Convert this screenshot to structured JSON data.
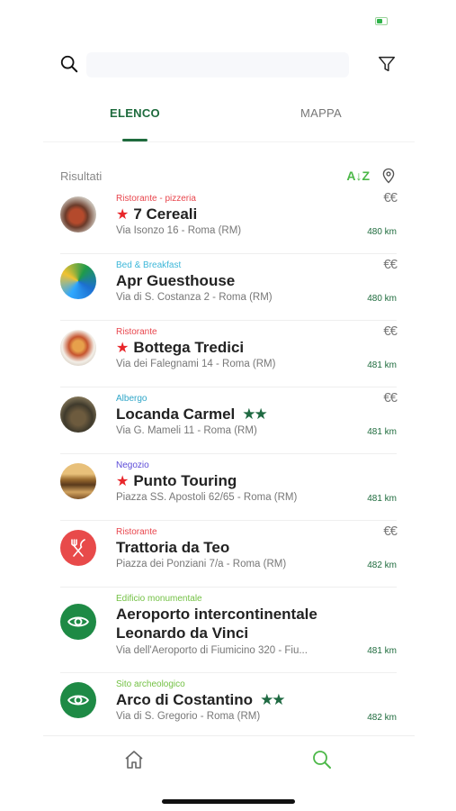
{
  "search": {
    "placeholder": "",
    "value": ""
  },
  "tabs": [
    {
      "label": "ELENCO",
      "active": true
    },
    {
      "label": "MAPPA",
      "active": false
    }
  ],
  "results": {
    "label": "Risultati",
    "sort_label": "A↓Z"
  },
  "items": [
    {
      "category": "Ristorante - pizzeria",
      "category_color": "#e8464d",
      "title": "7 Cereali",
      "red_star": true,
      "green_stars": "",
      "address": "Via Isonzo 16 - Roma (RM)",
      "price": "€€",
      "distance": "480 km"
    },
    {
      "category": "Bed & Breakfast",
      "category_color": "#3db7d9",
      "title": "Apr Guesthouse",
      "red_star": false,
      "green_stars": "",
      "address": "Via di S. Costanza 2 - Roma (RM)",
      "price": "€€",
      "distance": "480 km"
    },
    {
      "category": "Ristorante",
      "category_color": "#e8464d",
      "title": "Bottega Tredici",
      "red_star": true,
      "green_stars": "",
      "address": "Via dei Falegnami 14 - Roma (RM)",
      "price": "€€",
      "distance": "481 km"
    },
    {
      "category": "Albergo",
      "category_color": "#2fa6c8",
      "title": "Locanda Carmel",
      "red_star": false,
      "green_stars": "★★",
      "address": "Via G. Mameli 11 - Roma (RM)",
      "price": "€€",
      "distance": "481 km"
    },
    {
      "category": "Negozio",
      "category_color": "#5c4bd8",
      "title": "Punto Touring",
      "red_star": true,
      "green_stars": "",
      "address": "Piazza SS. Apostoli 62/65 - Roma (RM)",
      "price": "",
      "distance": "481 km"
    },
    {
      "category": "Ristorante",
      "category_color": "#e8464d",
      "title": "Trattoria da Teo",
      "red_star": false,
      "green_stars": "",
      "address": "Piazza dei Ponziani 7/a - Roma (RM)",
      "price": "€€",
      "distance": "482 km"
    },
    {
      "category": "Edificio monumentale",
      "category_color": "#73c144",
      "title_line1": "Aeroporto intercontinentale",
      "title_line2": "Leonardo da Vinci",
      "address": "Via dell'Aeroporto di Fiumicino 320 - Fiu...",
      "price": "",
      "distance": "481 km"
    },
    {
      "category": "Sito archeologico",
      "category_color": "#73c144",
      "title": "Arco di Costantino",
      "red_star": false,
      "green_stars": "★★",
      "address": "Via di S. Gregorio - Roma (RM)",
      "price": "",
      "distance": "482 km"
    }
  ],
  "icons": {
    "search": "search-icon",
    "filter": "filter-icon",
    "location": "location-pin-icon",
    "home": "home-icon",
    "search_tab": "search-icon"
  },
  "colors": {
    "accent": "#1e6b3d",
    "sort": "#4cb848",
    "red_star": "#e8262a",
    "green_star": "#1f6a42"
  }
}
